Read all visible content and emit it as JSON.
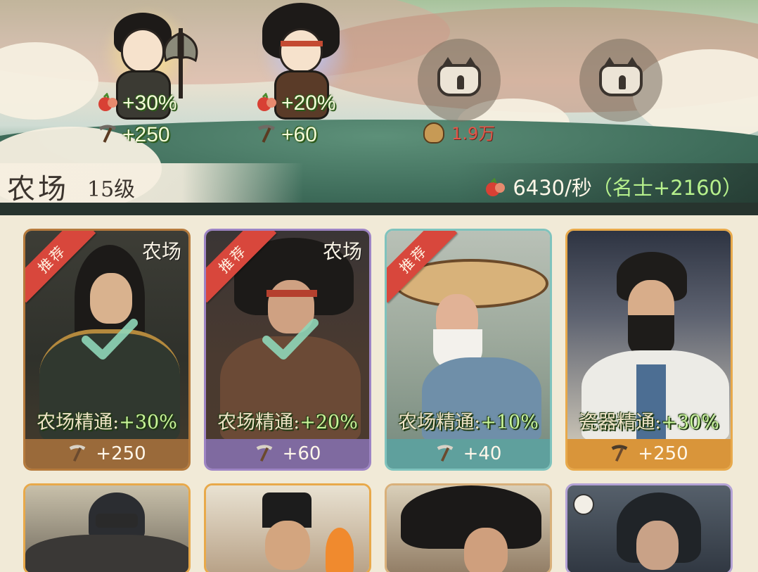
{
  "scene": {
    "heroes": [
      {
        "bonus_pct": "+30%",
        "bonus_flat": "+250",
        "glow": "#ffe68a"
      },
      {
        "bonus_pct": "+20%",
        "bonus_flat": "+60",
        "glow": "#b9c6ff"
      }
    ],
    "cost": "1.9万",
    "colors": {
      "bonus_text": "#f4fbd8",
      "cost_text": "#e0574a",
      "rate_bonus": "#b6f08c"
    }
  },
  "building": {
    "name": "农场",
    "level": "15级",
    "rate": "6430/秒",
    "rate_bonus": "（名士+2160）"
  },
  "cards": [
    {
      "ribbon": "推荐",
      "tag": "农场",
      "trait": "农场精通:",
      "trait_value": "+30%",
      "flat": "+250",
      "selected": true,
      "frame": "#b57a3c",
      "footer": "#9a6a3a"
    },
    {
      "ribbon": "推荐",
      "tag": "农场",
      "trait": "农场精通:",
      "trait_value": "+20%",
      "flat": "+60",
      "selected": true,
      "frame": "#9d84c4",
      "footer": "#7f6aa0"
    },
    {
      "ribbon": "推荐",
      "tag": "",
      "trait": "农场精通:",
      "trait_value": "+10%",
      "flat": "+40",
      "selected": false,
      "frame": "#7fc3bd",
      "footer": "#5fa09d"
    },
    {
      "ribbon": "",
      "tag": "",
      "trait": "瓷器精通:",
      "trait_value": "+30%",
      "flat": "+250",
      "selected": false,
      "frame": "#e8a94a",
      "footer": "#d9953a"
    }
  ],
  "row2_frames": [
    "#e8a94a",
    "#e8a94a",
    "#d9b07a",
    "#b4a2d6"
  ],
  "icons": [
    "apple-pomegranate-icon",
    "pickaxe-icon",
    "lock-cat-icon",
    "money-bag-icon",
    "checkmark-icon"
  ]
}
